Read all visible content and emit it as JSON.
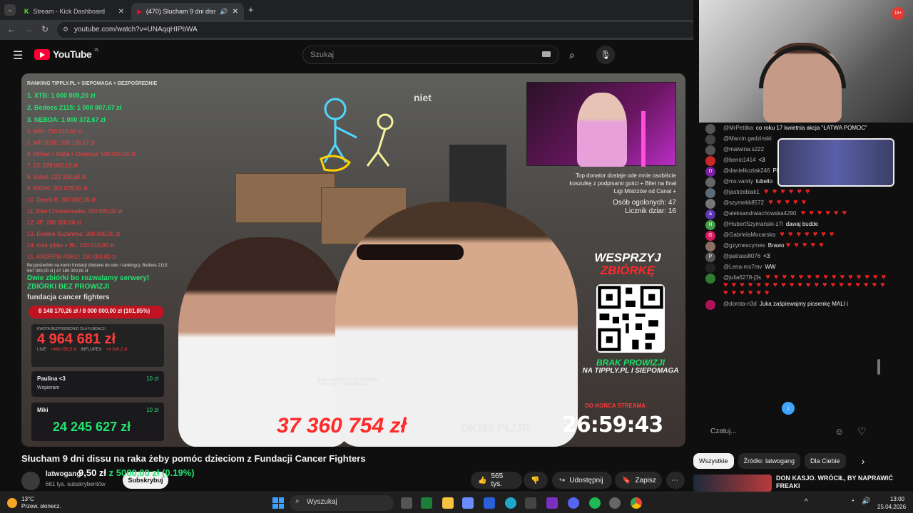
{
  "browser": {
    "tabs": [
      {
        "label": "Stream - Kick Dashboard"
      },
      {
        "label": "(470) Słucham 9 dni dissu n"
      }
    ],
    "url": "youtube.com/watch?v=UNAqqHIPbWA"
  },
  "youtube": {
    "logo": "YouTube",
    "region": "PL",
    "search_placeholder": "Szukaj"
  },
  "video": {
    "ranking_header": "RANKING TIPPLY.PL + SIEPOMAGA + BEZPOŚREDNIE",
    "ranking": [
      {
        "text": "1. XTB: 1 000 809,20 zł",
        "cls": "green"
      },
      {
        "text": "2. Bedoes 2115: 1 000 807,67 zł",
        "cls": "green"
      },
      {
        "text": "3. NEBOA: 1 000 372,67 zł",
        "cls": "green"
      },
      {
        "text": "4. Wiki: 710 010,69 zł",
        "cls": ""
      },
      {
        "text": "5. WK DZIK: 500 105,67 zł",
        "cls": ""
      },
      {
        "text": "6. InPost + Rafał + Omenaa: 500 000,00 zł",
        "cls": ""
      },
      {
        "text": "7. 23: 228 002,13 zł",
        "cls": ""
      },
      {
        "text": "8. Sobol: 222 315,69 zł",
        "cls": ""
      },
      {
        "text": "9. EKIPA: 201 079,00 zł",
        "cls": ""
      },
      {
        "text": "10. Dawid B: 200 092,06 zł",
        "cls": ""
      },
      {
        "text": "11. Ewa Chodakowska: 200 000,00 zł",
        "cls": ""
      },
      {
        "text": "12. 4F: 200 000,00 zł",
        "cls": ""
      },
      {
        "text": "13. Evelina Suzanova: 200 000,00 zł",
        "cls": ""
      },
      {
        "text": "14. matt gibbs + BL: 160 010,00 zł",
        "cls": ""
      },
      {
        "text": "15. ANDREW ASKO: 150 000,00 zł",
        "cls": ""
      }
    ],
    "direct_note": "Bezpośrednio na konto fundacji (dodane do celu i rankingu): Bedoes 2115: 567 000,00 zł | 47 180 000,00 zł",
    "two_fundraisers": "Dwie zbiórki bo rozwalamy serwery!",
    "no_commission": "ZBIÓRKI BEZ PROWIZJI",
    "cancer_fighters": "fundacja cancer fighters",
    "progress_text": "8 148 170,26 zł / 8 000 000,00 zł (101,85%)",
    "progress_fraction": 1.0,
    "direct_label": "KWOTA BEZPOŚREDNIO DLA FUNDACJI",
    "direct_amount": "4 964 681 zł",
    "live_label": "LIVE",
    "live_value": "+443 058,5 zł",
    "influpex_label": "INFLUPEX",
    "influpex_value": "+4 386,2 zł",
    "donors": [
      {
        "name": "Paulina <3",
        "amount": "10 zł",
        "note": "Wspieram"
      },
      {
        "name": "Miki",
        "amount": "10 zł",
        "note": ""
      }
    ],
    "green_total": "24 245 627 zł",
    "corner_text": "niet",
    "donor_info": "Top donator dostaje ode mnie osobiście koszulkę z podpisami gości + Bilet na finał Ligi Mistrzów od Canal +",
    "people_count": "Osób ogolonych: 47",
    "counter": "Licznik dziar: 16",
    "wesprzyj": "WESPRZYJ",
    "zbiorke": "ZBIÓRKĘ",
    "brak": "BRAK PROWIZJI",
    "brak_sub": "NA TIPPLY.PL I SIEPOMAGA",
    "sum_label": "SUMA WSZYSTKICH ZBIÓREK",
    "sum_sub": "TIPPLY.PL + SIEPOMAGA",
    "big_sum": "37 360 754 zł",
    "dkms": "DKMS.PL/JR",
    "until_end": "DO KOŃCA STREAMA",
    "timer": "26:59:43"
  },
  "info": {
    "title": "Słucham 9 dni dissu na raka żeby pomóc dzieciom z Fundacji Cancer Fighters",
    "channel": "latwogang",
    "subscribers": "661 tys. subskrybentów",
    "subscribe": "Subskrybuj",
    "goal_value": "9,50 zł",
    "goal_of": "z 5000,00 zł (0.19%)",
    "likes": "565 tys.",
    "share": "Udostępnij",
    "save": "Zapisz"
  },
  "chat": {
    "messages": [
      {
        "user": "@MrPetitka",
        "text": "co roku 17 kwietnia akcja \"ŁATWA POMOC\"",
        "hearts": "",
        "color": "#555",
        "initial": ""
      },
      {
        "user": "@Marcin.gadzinski",
        "text": "",
        "hearts": "",
        "color": "#444",
        "initial": ""
      },
      {
        "user": "@malwina.s222",
        "text": "",
        "hearts": "",
        "color": "#555",
        "initial": ""
      },
      {
        "user": "@benio1414",
        "text": "<3",
        "hearts": "",
        "color": "#c62828",
        "initial": ""
      },
      {
        "user": "@danielkoziak246",
        "text": "Pięknie 🔥 🔥 🔥 😉",
        "hearts": "",
        "color": "#7b1fa2",
        "initial": "D"
      },
      {
        "user": "@ms.vanity",
        "text": "lubello",
        "hearts": "",
        "color": "#666",
        "initial": ""
      },
      {
        "user": "@jastrzebiak1",
        "text": "",
        "hearts": "♥ ♥ ♥ ♥ ♥ ♥",
        "color": "#5a6b7a",
        "initial": ""
      },
      {
        "user": "@szymekk8572",
        "text": "",
        "hearts": "♥ ♥ ♥ ♥ ♥",
        "color": "#777",
        "initial": ""
      },
      {
        "user": "@aleksandralachowska4290",
        "text": "",
        "hearts": "♥ ♥ ♥ ♥ ♥ ♥",
        "color": "#5e35b1",
        "initial": "A"
      },
      {
        "user": "@HubertSzymański-z7l",
        "text": "dawaj budde",
        "hearts": "",
        "color": "#43a047",
        "initial": "H"
      },
      {
        "user": "@GabrielaMocarska",
        "text": "",
        "hearts": "♥ ♥ ♥ ♥ ♥ ♥ ♥",
        "color": "#d81b60",
        "initial": "G"
      },
      {
        "user": "@gzymescymes",
        "text": "Brawo",
        "hearts": "♥ ♥ ♥ ♥ ♥",
        "color": "#8d6e63",
        "initial": ""
      },
      {
        "user": "@patrass8076",
        "text": "<3",
        "hearts": "",
        "color": "#555",
        "initial": "P"
      },
      {
        "user": "@Lena-ms7mv",
        "text": "WW",
        "hearts": "",
        "color": "#222",
        "initial": ""
      },
      {
        "user": "@julia6278-j3s",
        "text": "",
        "hearts": "♥ ♥ ♥ ♥ ♥ ♥ ♥ ♥ ♥ ♥ ♥ ♥ ♥ ♥ ♥ ♥ ♥ ♥ ♥ ♥ ♥ ♥ ♥ ♥ ♥ ♥ ♥ ♥ ♥ ♥ ♥ ♥ ♥ ♥ ♥ ♥ ♥ ♥ ♥ ♥ ♥",
        "color": "#2e7d32",
        "initial": ""
      },
      {
        "user": "@dorota-n3d",
        "text": "Juka zaśpiewajmy piosenkę MALI i",
        "hearts": "",
        "color": "#ad1457",
        "initial": ""
      }
    ],
    "input_placeholder": "Czatuj..."
  },
  "chips": [
    "Wszystkie",
    "Źródło: latwogang",
    "Dla Ciebie"
  ],
  "recommended": {
    "title": "DON KASJO. WRÓCIŁ, BY NAPRAWIĆ FREAKI"
  },
  "taskbar": {
    "temp": "13°C",
    "weather": "Przew. słonecz.",
    "search": "Wyszukaj",
    "time": "13:00",
    "date": "25.04.2026"
  },
  "colors": {
    "yt_red": "#ff0033",
    "heart": "#e62020",
    "green": "#22e46f",
    "ranking_red": "#ff3b3b"
  }
}
